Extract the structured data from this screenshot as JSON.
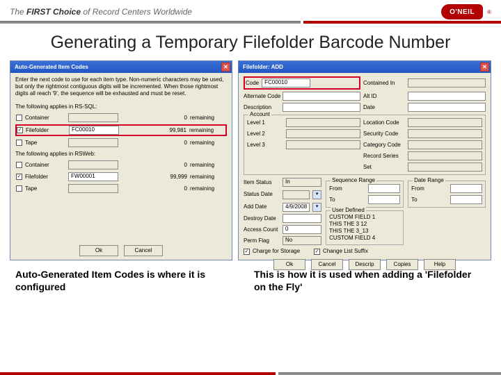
{
  "header": {
    "tagline_pre": "The ",
    "tagline_strong": "FIRST Choice",
    "tagline_post": " of Record Centers Worldwide",
    "logo_text": "O'NEIL"
  },
  "slide": {
    "title": "Generating a Temporary Filefolder Barcode Number"
  },
  "dlg_left": {
    "title": "Auto-Generated Item Codes",
    "instr": "Enter the next code to use for each item type. Non-numeric characters may be used, but only the rightmost contiguous digits will be incremented. When those rightmost digits all reach '9', the sequence will be exhausted and must be reset.",
    "note_sql": "The following applies in RS-SQL:",
    "note_web": "The following applies in RSWeb:",
    "rows_sql": [
      {
        "label": "Container",
        "value": "",
        "remaining": "0",
        "remtxt": "remaining",
        "checked": false
      },
      {
        "label": "Filefolder",
        "value": "FC00010",
        "remaining": "99,981",
        "remtxt": "remaining",
        "checked": true,
        "hl": true
      },
      {
        "label": "Tape",
        "value": "",
        "remaining": "0",
        "remtxt": "remaining",
        "checked": false
      }
    ],
    "rows_web": [
      {
        "label": "Container",
        "value": "",
        "remaining": "0",
        "remtxt": "remaining",
        "checked": false
      },
      {
        "label": "Filefolder",
        "value": "FW00001",
        "remaining": "99,999",
        "remtxt": "remaining",
        "checked": true
      },
      {
        "label": "Tape",
        "value": "",
        "remaining": "0",
        "remtxt": "remaining",
        "checked": false
      }
    ],
    "ok": "Ok",
    "cancel": "Cancel"
  },
  "dlg_right": {
    "title": "Filefolder: ADD",
    "labels": {
      "code": "Code",
      "alt_code": "Alternate Code",
      "desc": "Description",
      "contained": "Contained In",
      "altid": "Alt ID",
      "date": "Date",
      "account": "Account",
      "loc": "Location Code",
      "l1": "Level 1",
      "l2": "Level 2",
      "l3": "Level 3",
      "sec": "Security Code",
      "cat": "Category Code",
      "rec": "Record Series",
      "set": "Set",
      "status": "Item Status",
      "status_val": "In",
      "status_dt": "Status Date",
      "add_date": "Add Date",
      "add_date_val": "4/9/2008",
      "destroy": "Destroy Date",
      "access": "Access Count",
      "access_val": "0",
      "perm": "Perm Flag",
      "perm_val": "No",
      "seq": "Sequence Range",
      "from": "From",
      "to": "To",
      "dater": "Date Range",
      "udef": "User Defined",
      "u1": "CUSTOM FIELD 1",
      "u2": "THIS THE 3 12",
      "u3": "THIS THE 3_13",
      "u4": "CUSTOM FIELD 4",
      "charge": "Charge for Storage",
      "chg_rslt": "Change List Suffix"
    },
    "code_value": "FC00010",
    "buttons": {
      "ok": "Ok",
      "cancel": "Cancel",
      "descrip": "Descrip",
      "copies": "Copies",
      "help": "Help"
    }
  },
  "captions": {
    "left": "Auto-Generated Item Codes is where it is configured",
    "right": "This is how it is used when adding a 'Filefolder on the Fly'"
  }
}
